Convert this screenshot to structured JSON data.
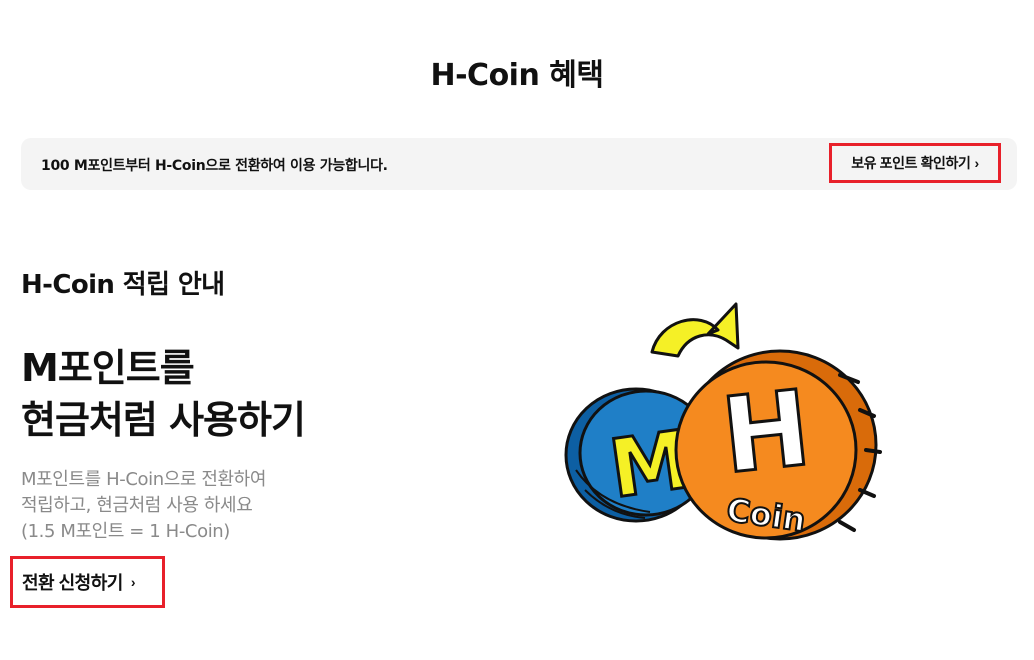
{
  "header": {
    "title": "H-Coin 혜택"
  },
  "notice": {
    "text": "100 M포인트부터 H-Coin으로 전환하여 이용 가능합니다.",
    "check_points_label": "보유 포인트 확인하기"
  },
  "guide": {
    "section_title": "H-Coin 적립 안내",
    "headline": [
      "M포인트를",
      "현금처럼 사용하기"
    ],
    "description": [
      "M포인트를 H-Coin으로 전환하여",
      "적립하고, 현금처럼 사용 하세요",
      "(1.5 M포인트 = 1 H-Coin)"
    ],
    "apply_label": "전환 신청하기"
  },
  "illustration": {
    "m_coin_letter": "M",
    "h_coin_letter": "H",
    "h_coin_word": "Coin",
    "icons": [
      "chevron-right-icon",
      "conversion-arrow-icon",
      "m-coin-icon",
      "h-coin-icon"
    ]
  },
  "colors": {
    "accent_border": "#e8202a",
    "notice_bg": "#f4f4f4",
    "description_text": "#8a8a8a",
    "m_coin": "#1f7fc7",
    "h_coin": "#f58a1f",
    "arrow": "#f5f026"
  }
}
